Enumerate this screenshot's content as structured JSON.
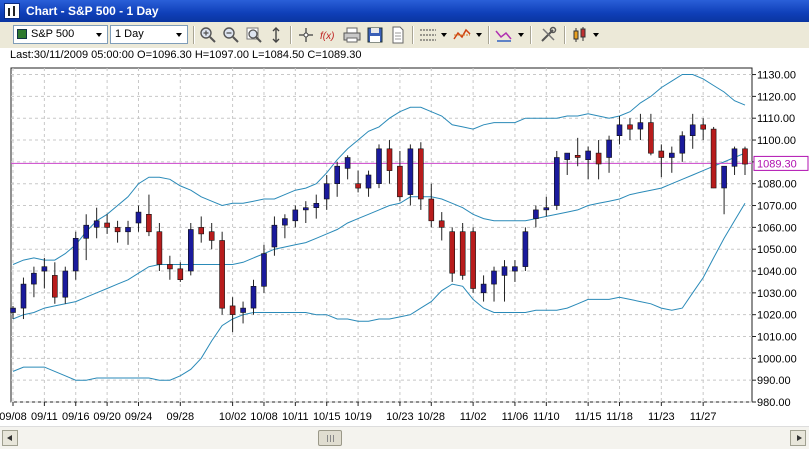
{
  "window": {
    "title": "Chart - S&P 500 - 1 Day"
  },
  "toolbar": {
    "symbol": "S&P 500",
    "period": "1 Day",
    "icons": [
      "zoom-in-icon",
      "zoom-out-icon",
      "zoom-fit-icon",
      "axis-scale-icon",
      "crosshair-icon",
      "tick-chart-icon",
      "print-icon",
      "save-icon",
      "document-icon",
      "grid-icon",
      "style-icon",
      "indicator-icon",
      "tools-icon",
      "bars-type-icon"
    ]
  },
  "info": {
    "text": "Last:30/11/2009 05:00:00 O=1096.30 H=1097.00 L=1084.50 C=1089.30"
  },
  "colors": {
    "up": "#1a1a9c",
    "down": "#b81c1c",
    "band": "#2a8ab8",
    "lastline": "#cc44cc",
    "lastlabel": "#b010b0"
  },
  "chart_data": {
    "type": "candlestick",
    "ylim": [
      980,
      1133
    ],
    "y_ticks": [
      "980.00",
      "990.00",
      "1000.00",
      "1010.00",
      "1020.00",
      "1030.00",
      "1040.00",
      "1050.00",
      "1060.00",
      "1070.00",
      "1080.00",
      "1090.00",
      "1100.00",
      "1110.00",
      "1120.00",
      "1130.00"
    ],
    "x_tick_labels": [
      "09/08",
      "09/11",
      "09/16",
      "09/20",
      "09/24",
      "09/28",
      "10/02",
      "10/08",
      "10/11",
      "10/15",
      "10/19",
      "10/23",
      "10/28",
      "11/02",
      "11/06",
      "11/10",
      "11/15",
      "11/18",
      "11/23",
      "11/27"
    ],
    "x_tick_positions": [
      0,
      3,
      6,
      9,
      12,
      16,
      21,
      24,
      27,
      30,
      33,
      37,
      40,
      44,
      48,
      51,
      55,
      58,
      62,
      66
    ],
    "last_price": "1089.30",
    "grid": true,
    "candles": [
      {
        "o": 1021,
        "h": 1024,
        "l": 1018,
        "c": 1023
      },
      {
        "o": 1023,
        "h": 1037,
        "l": 1018,
        "c": 1034
      },
      {
        "o": 1034,
        "h": 1042,
        "l": 1028,
        "c": 1039
      },
      {
        "o": 1040,
        "h": 1046,
        "l": 1032,
        "c": 1042
      },
      {
        "o": 1038,
        "h": 1044,
        "l": 1025,
        "c": 1028
      },
      {
        "o": 1028,
        "h": 1042,
        "l": 1025,
        "c": 1040
      },
      {
        "o": 1040,
        "h": 1058,
        "l": 1036,
        "c": 1055
      },
      {
        "o": 1055,
        "h": 1066,
        "l": 1045,
        "c": 1061
      },
      {
        "o": 1060,
        "h": 1069,
        "l": 1055,
        "c": 1063
      },
      {
        "o": 1062,
        "h": 1066,
        "l": 1057,
        "c": 1060
      },
      {
        "o": 1060,
        "h": 1063,
        "l": 1053,
        "c": 1058
      },
      {
        "o": 1058,
        "h": 1063,
        "l": 1052,
        "c": 1060
      },
      {
        "o": 1062,
        "h": 1070,
        "l": 1058,
        "c": 1067
      },
      {
        "o": 1066,
        "h": 1075,
        "l": 1056,
        "c": 1058
      },
      {
        "o": 1058,
        "h": 1062,
        "l": 1040,
        "c": 1043
      },
      {
        "o": 1043,
        "h": 1047,
        "l": 1036,
        "c": 1041
      },
      {
        "o": 1041,
        "h": 1044,
        "l": 1035,
        "c": 1036
      },
      {
        "o": 1040,
        "h": 1062,
        "l": 1038,
        "c": 1059
      },
      {
        "o": 1060,
        "h": 1065,
        "l": 1053,
        "c": 1057
      },
      {
        "o": 1058,
        "h": 1062,
        "l": 1050,
        "c": 1054
      },
      {
        "o": 1054,
        "h": 1058,
        "l": 1020,
        "c": 1023
      },
      {
        "o": 1024,
        "h": 1028,
        "l": 1012,
        "c": 1020
      },
      {
        "o": 1021,
        "h": 1026,
        "l": 1016,
        "c": 1023
      },
      {
        "o": 1023,
        "h": 1036,
        "l": 1020,
        "c": 1033
      },
      {
        "o": 1033,
        "h": 1052,
        "l": 1030,
        "c": 1048
      },
      {
        "o": 1051,
        "h": 1065,
        "l": 1047,
        "c": 1061
      },
      {
        "o": 1061,
        "h": 1066,
        "l": 1055,
        "c": 1064
      },
      {
        "o": 1063,
        "h": 1070,
        "l": 1060,
        "c": 1068
      },
      {
        "o": 1068,
        "h": 1072,
        "l": 1062,
        "c": 1069
      },
      {
        "o": 1069,
        "h": 1075,
        "l": 1064,
        "c": 1071
      },
      {
        "o": 1073,
        "h": 1084,
        "l": 1068,
        "c": 1080
      },
      {
        "o": 1080,
        "h": 1090,
        "l": 1074,
        "c": 1088
      },
      {
        "o": 1087,
        "h": 1093,
        "l": 1082,
        "c": 1092
      },
      {
        "o": 1080,
        "h": 1086,
        "l": 1076,
        "c": 1078
      },
      {
        "o": 1078,
        "h": 1086,
        "l": 1074,
        "c": 1084
      },
      {
        "o": 1080,
        "h": 1098,
        "l": 1078,
        "c": 1096
      },
      {
        "o": 1096,
        "h": 1100,
        "l": 1080,
        "c": 1086
      },
      {
        "o": 1088,
        "h": 1095,
        "l": 1072,
        "c": 1074
      },
      {
        "o": 1075,
        "h": 1098,
        "l": 1070,
        "c": 1096
      },
      {
        "o": 1096,
        "h": 1099,
        "l": 1068,
        "c": 1073
      },
      {
        "o": 1073,
        "h": 1080,
        "l": 1060,
        "c": 1063
      },
      {
        "o": 1063,
        "h": 1067,
        "l": 1054,
        "c": 1060
      },
      {
        "o": 1058,
        "h": 1060,
        "l": 1035,
        "c": 1039
      },
      {
        "o": 1058,
        "h": 1062,
        "l": 1036,
        "c": 1038
      },
      {
        "o": 1058,
        "h": 1060,
        "l": 1030,
        "c": 1032
      },
      {
        "o": 1030,
        "h": 1038,
        "l": 1026,
        "c": 1034
      },
      {
        "o": 1034,
        "h": 1042,
        "l": 1026,
        "c": 1040
      },
      {
        "o": 1038,
        "h": 1045,
        "l": 1026,
        "c": 1042
      },
      {
        "o": 1040,
        "h": 1045,
        "l": 1035,
        "c": 1042
      },
      {
        "o": 1042,
        "h": 1060,
        "l": 1040,
        "c": 1058
      },
      {
        "o": 1064,
        "h": 1070,
        "l": 1060,
        "c": 1068
      },
      {
        "o": 1068,
        "h": 1074,
        "l": 1065,
        "c": 1069
      },
      {
        "o": 1070,
        "h": 1095,
        "l": 1068,
        "c": 1092
      },
      {
        "o": 1091,
        "h": 1094,
        "l": 1084,
        "c": 1094
      },
      {
        "o": 1093,
        "h": 1101,
        "l": 1088,
        "c": 1092
      },
      {
        "o": 1091,
        "h": 1097,
        "l": 1082,
        "c": 1095
      },
      {
        "o": 1094,
        "h": 1100,
        "l": 1082,
        "c": 1089
      },
      {
        "o": 1092,
        "h": 1102,
        "l": 1085,
        "c": 1100
      },
      {
        "o": 1102,
        "h": 1111,
        "l": 1098,
        "c": 1107
      },
      {
        "o": 1107,
        "h": 1110,
        "l": 1100,
        "c": 1105
      },
      {
        "o": 1105,
        "h": 1112,
        "l": 1100,
        "c": 1108
      },
      {
        "o": 1108,
        "h": 1112,
        "l": 1093,
        "c": 1094
      },
      {
        "o": 1095,
        "h": 1098,
        "l": 1083,
        "c": 1092
      },
      {
        "o": 1092,
        "h": 1097,
        "l": 1085,
        "c": 1094
      },
      {
        "o": 1094,
        "h": 1104,
        "l": 1090,
        "c": 1102
      },
      {
        "o": 1102,
        "h": 1112,
        "l": 1096,
        "c": 1107
      },
      {
        "o": 1107,
        "h": 1110,
        "l": 1100,
        "c": 1105
      },
      {
        "o": 1105,
        "h": 1106,
        "l": 1078,
        "c": 1078
      },
      {
        "o": 1078,
        "h": 1085,
        "l": 1066,
        "c": 1088
      },
      {
        "o": 1088,
        "h": 1097,
        "l": 1084,
        "c": 1096
      },
      {
        "o": 1096,
        "h": 1097,
        "l": 1084,
        "c": 1089
      }
    ],
    "bands": {
      "upper": [
        1043,
        1045,
        1046,
        1045,
        1045,
        1048,
        1052,
        1058,
        1063,
        1066,
        1070,
        1074,
        1080,
        1083,
        1083,
        1082,
        1079,
        1077,
        1074,
        1072,
        1070,
        1071,
        1071,
        1072,
        1073,
        1073,
        1075,
        1077,
        1078,
        1080,
        1085,
        1091,
        1096,
        1100,
        1104,
        1106,
        1110,
        1113,
        1115,
        1115,
        1113,
        1111,
        1107,
        1106,
        1105,
        1107,
        1108,
        1108,
        1108,
        1110,
        1110,
        1110,
        1110,
        1111,
        1111,
        1112,
        1111,
        1110,
        1111,
        1113,
        1117,
        1120,
        1124,
        1127,
        1130,
        1130,
        1128,
        1125,
        1122,
        1118,
        1116
      ],
      "middle": [
        1018,
        1020,
        1021,
        1023,
        1024,
        1025,
        1026,
        1028,
        1030,
        1032,
        1034,
        1036,
        1039,
        1042,
        1043,
        1043,
        1043,
        1043,
        1043,
        1043,
        1043,
        1043,
        1044,
        1046,
        1048,
        1050,
        1051,
        1052,
        1053,
        1055,
        1057,
        1059,
        1062,
        1064,
        1066,
        1068,
        1070,
        1071,
        1074,
        1074,
        1074,
        1073,
        1071,
        1069,
        1066,
        1064,
        1063,
        1063,
        1063,
        1063,
        1064,
        1065,
        1066,
        1067,
        1068,
        1070,
        1071,
        1072,
        1073,
        1075,
        1076,
        1077,
        1078,
        1080,
        1082,
        1084,
        1086,
        1088,
        1090,
        1092,
        1094
      ],
      "lower": [
        994,
        996,
        996,
        996,
        994,
        992,
        990,
        990,
        991,
        991,
        991,
        991,
        991,
        991,
        990,
        990,
        992,
        995,
        1000,
        1008,
        1015,
        1018,
        1020,
        1021,
        1021,
        1021,
        1021,
        1021,
        1021,
        1020,
        1020,
        1018,
        1018,
        1017,
        1017,
        1018,
        1018,
        1019,
        1020,
        1023,
        1026,
        1031,
        1034,
        1033,
        1027,
        1023,
        1021,
        1021,
        1021,
        1021,
        1022,
        1022,
        1022,
        1023,
        1025,
        1027,
        1027,
        1027,
        1028,
        1027,
        1026,
        1025,
        1023,
        1022,
        1023,
        1030,
        1037,
        1046,
        1055,
        1063,
        1071
      ]
    }
  }
}
